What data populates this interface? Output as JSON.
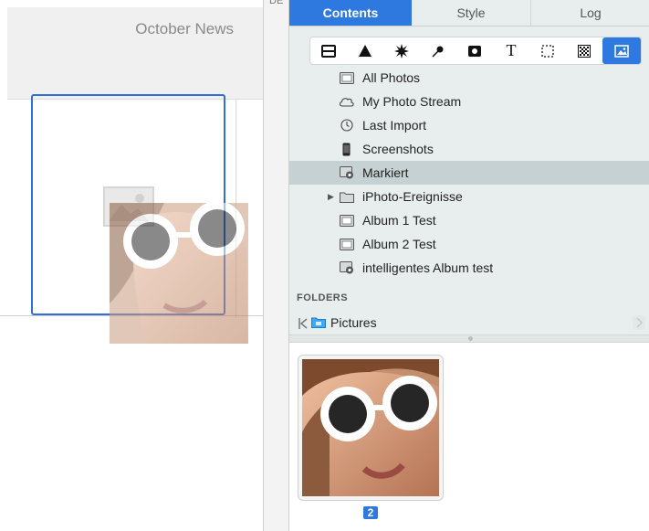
{
  "canvas": {
    "page_title": "October News"
  },
  "divider": {
    "label": "DE"
  },
  "tabs": [
    {
      "label": "Contents"
    },
    {
      "label": "Style"
    },
    {
      "label": "Log"
    }
  ],
  "toolbar": {
    "text_tool_label": "T",
    "tools": [
      "box-icon",
      "triangle-icon",
      "starburst-icon",
      "pin-icon",
      "video-icon",
      "text-icon",
      "selection-icon",
      "texture-icon",
      "photo-icon"
    ]
  },
  "sources": {
    "items": [
      {
        "label": "All Photos",
        "icon": "album-icon"
      },
      {
        "label": "My Photo Stream",
        "icon": "cloud-icon"
      },
      {
        "label": "Last Import",
        "icon": "clock-icon"
      },
      {
        "label": "Screenshots",
        "icon": "phone-icon"
      },
      {
        "label": "Markiert",
        "icon": "smart-album-icon",
        "selected": true
      },
      {
        "label": "iPhoto-Ereignisse",
        "icon": "folder-icon"
      },
      {
        "label": "Album 1 Test",
        "icon": "album-icon"
      },
      {
        "label": "Album 2 Test",
        "icon": "album-icon"
      },
      {
        "label": "intelligentes Album test",
        "icon": "smart-album-icon"
      }
    ],
    "folders_header": "FOLDERS",
    "folder_label": "Pictures"
  },
  "grid": {
    "count_badge": "2"
  },
  "colors": {
    "accent": "#2e79e0",
    "selection_row": "#c5d1d3",
    "panel_bg": "#e8edee"
  }
}
